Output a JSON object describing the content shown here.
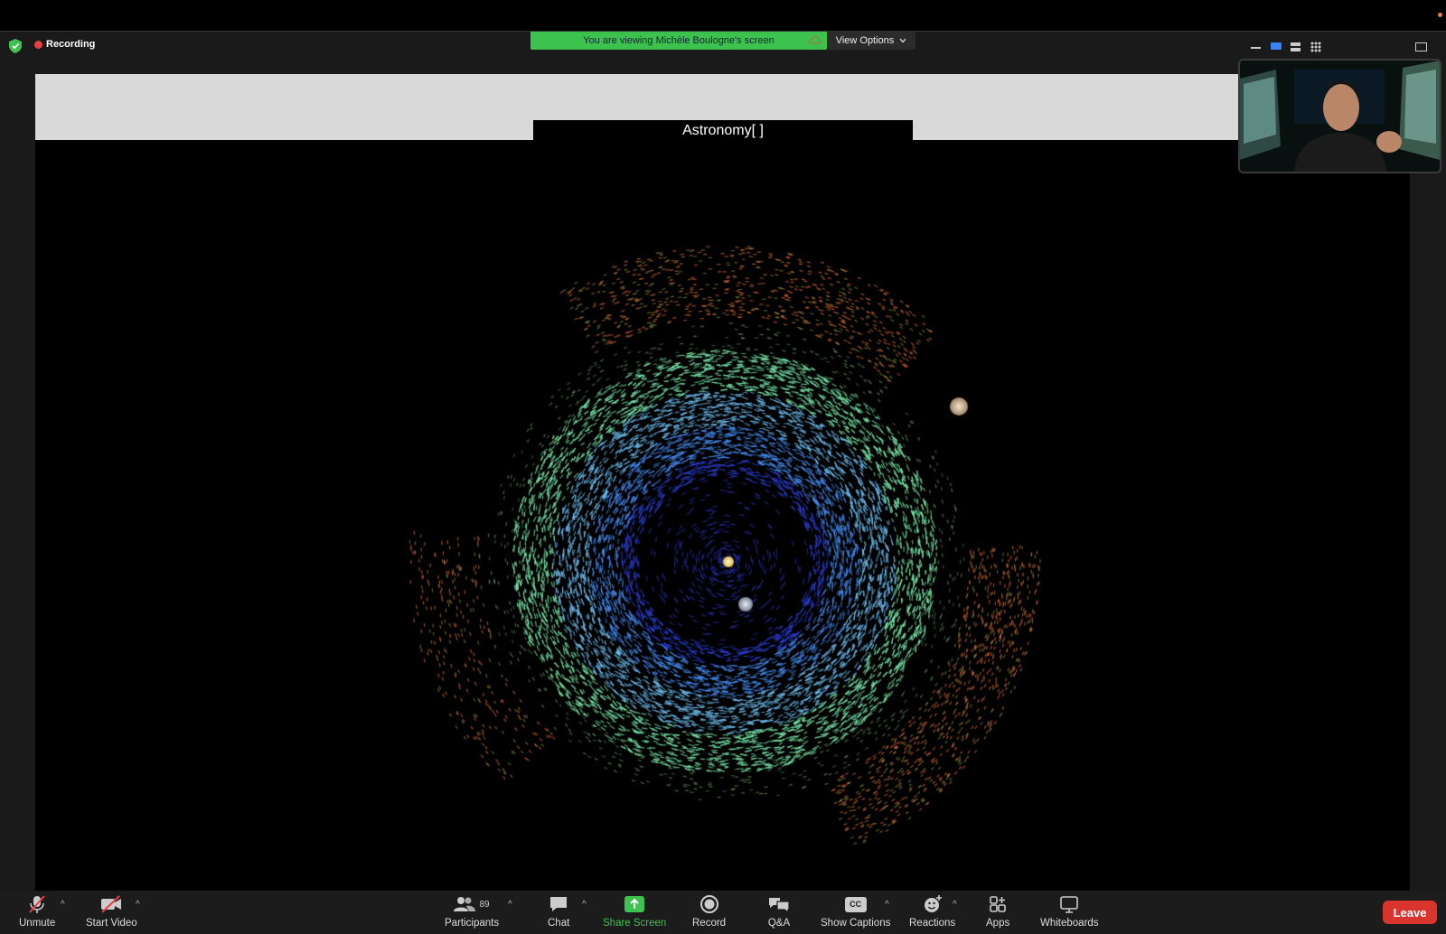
{
  "recording": {
    "label": "Recording"
  },
  "banner": {
    "text": "You are viewing Michèle Boulogne's screen",
    "view_options": "View Options"
  },
  "shared_screen": {
    "title": "Astronomy[ ]"
  },
  "toolbar": {
    "unmute": "Unmute",
    "start_video": "Start Video",
    "participants": "Participants",
    "participants_count": "89",
    "chat": "Chat",
    "share_screen": "Share Screen",
    "record": "Record",
    "qa": "Q&A",
    "show_captions": "Show Captions",
    "cc": "CC",
    "reactions": "Reactions",
    "apps": "Apps",
    "whiteboards": "Whiteboards",
    "leave": "Leave"
  },
  "colors": {
    "accent_green": "#3ec24f",
    "leave_red": "#d9352e",
    "recording_red": "#e84040"
  },
  "icons": [
    "shield-icon",
    "recording-dot-icon",
    "cloud-icon",
    "chevron-down-icon",
    "muted-mic-icon",
    "video-off-icon",
    "participants-icon",
    "chat-icon",
    "share-screen-icon",
    "record-icon",
    "qa-icon",
    "captions-icon",
    "reactions-icon",
    "apps-icon",
    "whiteboard-icon"
  ]
}
